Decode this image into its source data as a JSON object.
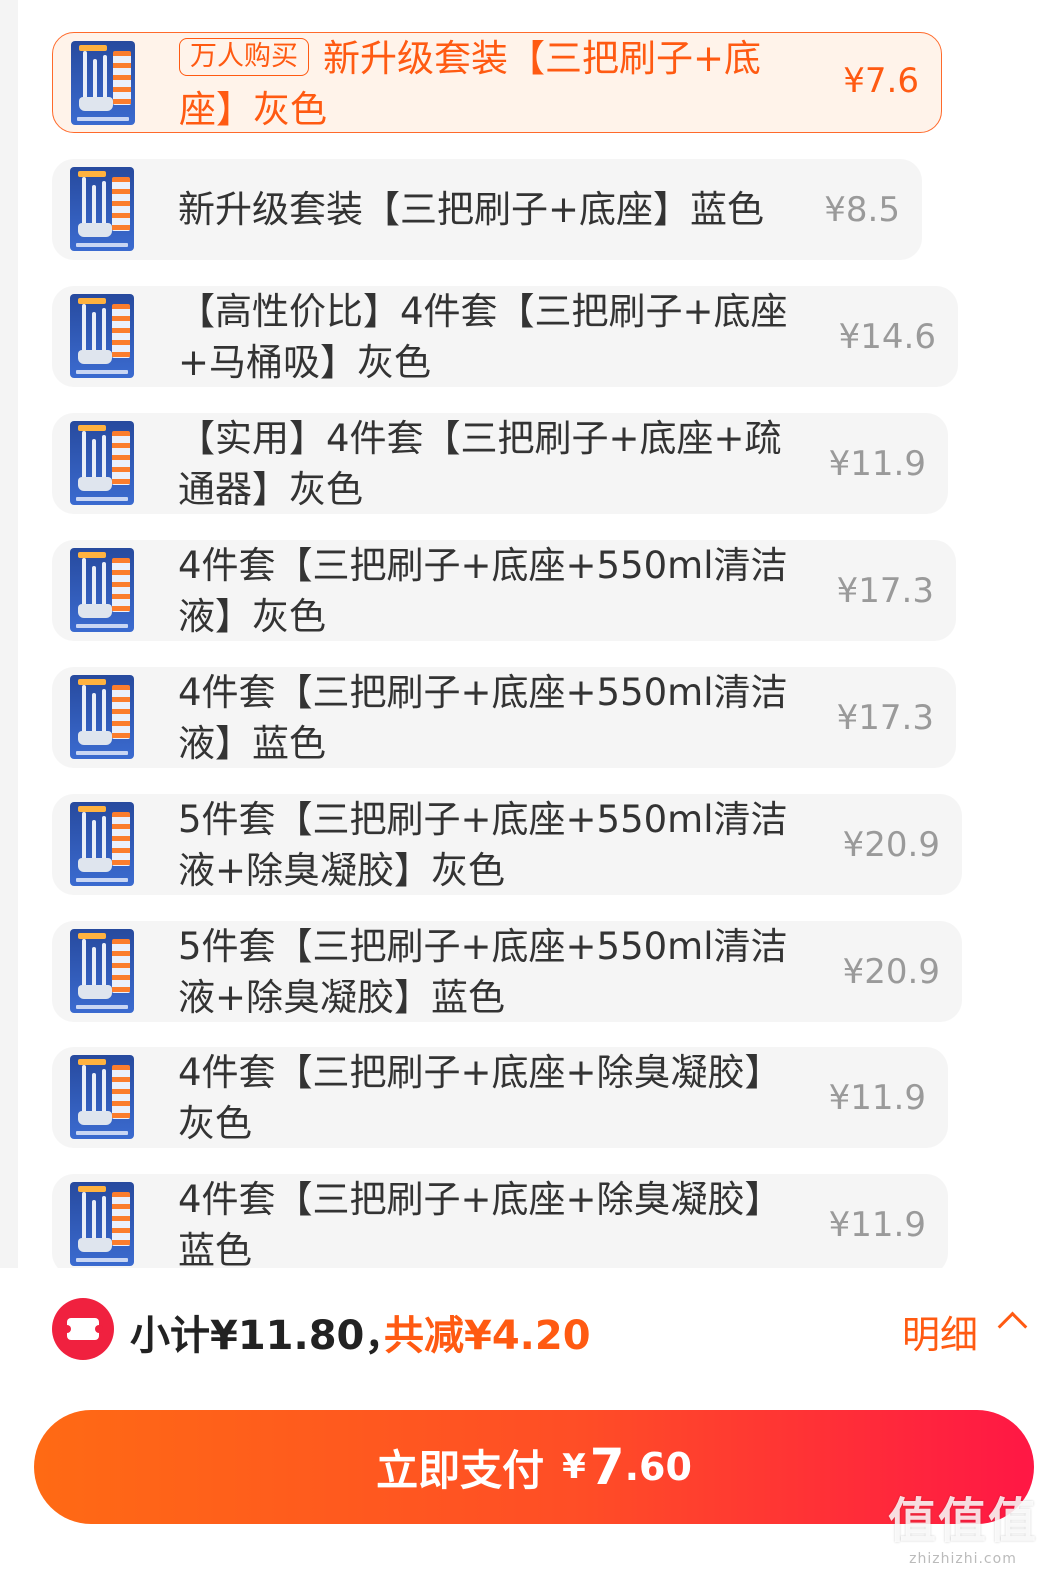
{
  "options": [
    {
      "tag": "万人购买",
      "name": "新升级套装【三把刷子+底座】灰色",
      "price": "¥7.6",
      "selected": true
    },
    {
      "name": "新升级套装【三把刷子+底座】蓝色",
      "price": "¥8.5",
      "selected": false
    },
    {
      "name": "【高性价比】4件套【三把刷子+底座+马桶吸】灰色",
      "price": "¥14.6",
      "selected": false
    },
    {
      "name": "【实用】4件套【三把刷子+底座+疏通器】灰色",
      "price": "¥11.9",
      "selected": false
    },
    {
      "name": "4件套【三把刷子+底座+550ml清洁液】灰色",
      "price": "¥17.3",
      "selected": false
    },
    {
      "name": "4件套【三把刷子+底座+550ml清洁液】蓝色",
      "price": "¥17.3",
      "selected": false
    },
    {
      "name": "5件套【三把刷子+底座+550ml清洁液+除臭凝胶】灰色",
      "price": "¥20.9",
      "selected": false
    },
    {
      "name": "5件套【三把刷子+底座+550ml清洁液+除臭凝胶】蓝色",
      "price": "¥20.9",
      "selected": false
    },
    {
      "name": "4件套【三把刷子+底座+除臭凝胶】灰色",
      "price": "¥11.9",
      "selected": false
    },
    {
      "name": "4件套【三把刷子+底座+除臭凝胶】蓝色",
      "price": "¥11.9",
      "selected": false
    }
  ],
  "footer": {
    "subtotal": "小计¥11.80，",
    "discount": "共减¥4.20",
    "detail_label": "明细",
    "pay_label": "立即支付",
    "pay_currency": "¥",
    "pay_integer": "7",
    "pay_decimal": ".60"
  },
  "watermark": {
    "chars": "值值值",
    "site": "zhizhizhi.com"
  },
  "colors": {
    "accent": "#ff5a12",
    "selected_bg": "#fff3ea",
    "pay_gradient_end": "#ff1745"
  }
}
